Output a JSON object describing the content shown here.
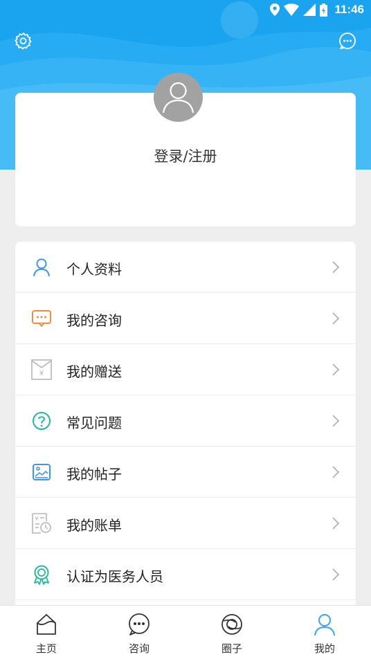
{
  "status_bar": {
    "time": "11:46"
  },
  "profile": {
    "login_label": "登录/注册"
  },
  "menu": {
    "items": [
      {
        "label": "个人资料",
        "icon": "user-icon",
        "color": "#3b97e6"
      },
      {
        "label": "我的咨询",
        "icon": "chat-bubble-icon",
        "color": "#f08a3c"
      },
      {
        "label": "我的赠送",
        "icon": "gift-envelope-icon",
        "color": "#b5b5b5"
      },
      {
        "label": "常见问题",
        "icon": "question-icon",
        "color": "#23b89a"
      },
      {
        "label": "我的帖子",
        "icon": "post-image-icon",
        "color": "#3b97e6"
      },
      {
        "label": "我的账单",
        "icon": "bill-icon",
        "color": "#b5b5b5"
      },
      {
        "label": "认证为医务人员",
        "icon": "badge-icon",
        "color": "#23b89a"
      }
    ]
  },
  "bottom_nav": {
    "items": [
      {
        "label": "主页",
        "icon": "home-icon"
      },
      {
        "label": "咨询",
        "icon": "consult-icon"
      },
      {
        "label": "圈子",
        "icon": "circle-icon"
      },
      {
        "label": "我的",
        "icon": "profile-icon",
        "active": true
      }
    ]
  },
  "colors": {
    "accent": "#1aa3ef",
    "active_nav": "#3aa4ee"
  }
}
